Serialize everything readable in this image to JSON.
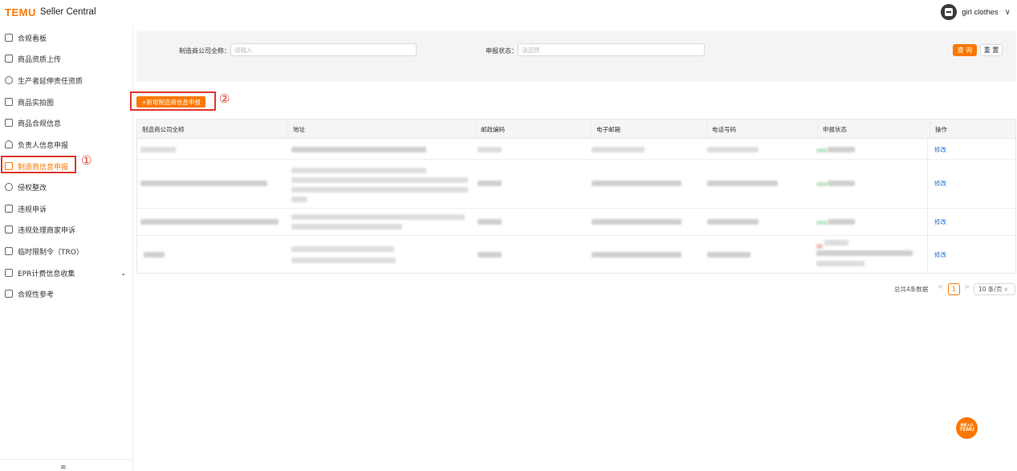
{
  "header": {
    "logo": "TEMU",
    "app_name": "Seller Central",
    "user_name": "girl clothes",
    "user_chevron": "∨"
  },
  "sidebar": {
    "items": [
      {
        "label": "合规看板",
        "icon": "dashboard-icon"
      },
      {
        "label": "商品资质上传",
        "icon": "upload-icon"
      },
      {
        "label": "生产者延伸责任资质",
        "icon": "certificate-icon"
      },
      {
        "label": "商品实拍图",
        "icon": "image-icon"
      },
      {
        "label": "商品合规信息",
        "icon": "document-icon"
      },
      {
        "label": "负责人信息申报",
        "icon": "person-icon"
      },
      {
        "label": "制造商信息申报",
        "icon": "factory-icon",
        "active": true
      },
      {
        "label": "侵权整改",
        "icon": "info-icon"
      },
      {
        "label": "违规申诉",
        "icon": "appeal-icon"
      },
      {
        "label": "违规处理商家申诉",
        "icon": "complaint-icon"
      },
      {
        "label": "临时限制令（TRO）",
        "icon": "restriction-icon"
      },
      {
        "label": "EPR计费信息收集",
        "icon": "billing-icon",
        "expandable": true
      },
      {
        "label": "合规性参考",
        "icon": "reference-icon"
      }
    ],
    "expand_chevron": "⌄",
    "collapse_glyph": "≡"
  },
  "annotations": {
    "marker_1": "①",
    "marker_2": "②"
  },
  "filters": {
    "company_label": "制造商公司全称：",
    "company_placeholder": "请输入",
    "status_label": "申报状态：",
    "status_placeholder": "请选择",
    "query_button": "查 询",
    "reset_button": "重 置"
  },
  "add_button": "+新增制造商信息申报",
  "table": {
    "columns": [
      "制造商公司全称",
      "地址",
      "邮政编码",
      "电子邮箱",
      "电话号码",
      "申报状态",
      "操作"
    ],
    "rows": [
      {
        "action": "修改"
      },
      {
        "action": "修改"
      },
      {
        "action": "修改"
      },
      {
        "action": "修改"
      }
    ]
  },
  "pagination": {
    "total_text": "总共4条数据",
    "prev": "<",
    "current_page": "1",
    "next": ">",
    "page_size": "10 条/页"
  },
  "floating_badge": {
    "top_text": "商家入口",
    "brand": "TEMU"
  },
  "colors": {
    "accent": "#fb7701",
    "annotation_red": "#e0382b",
    "link_blue": "#1f70d9"
  }
}
